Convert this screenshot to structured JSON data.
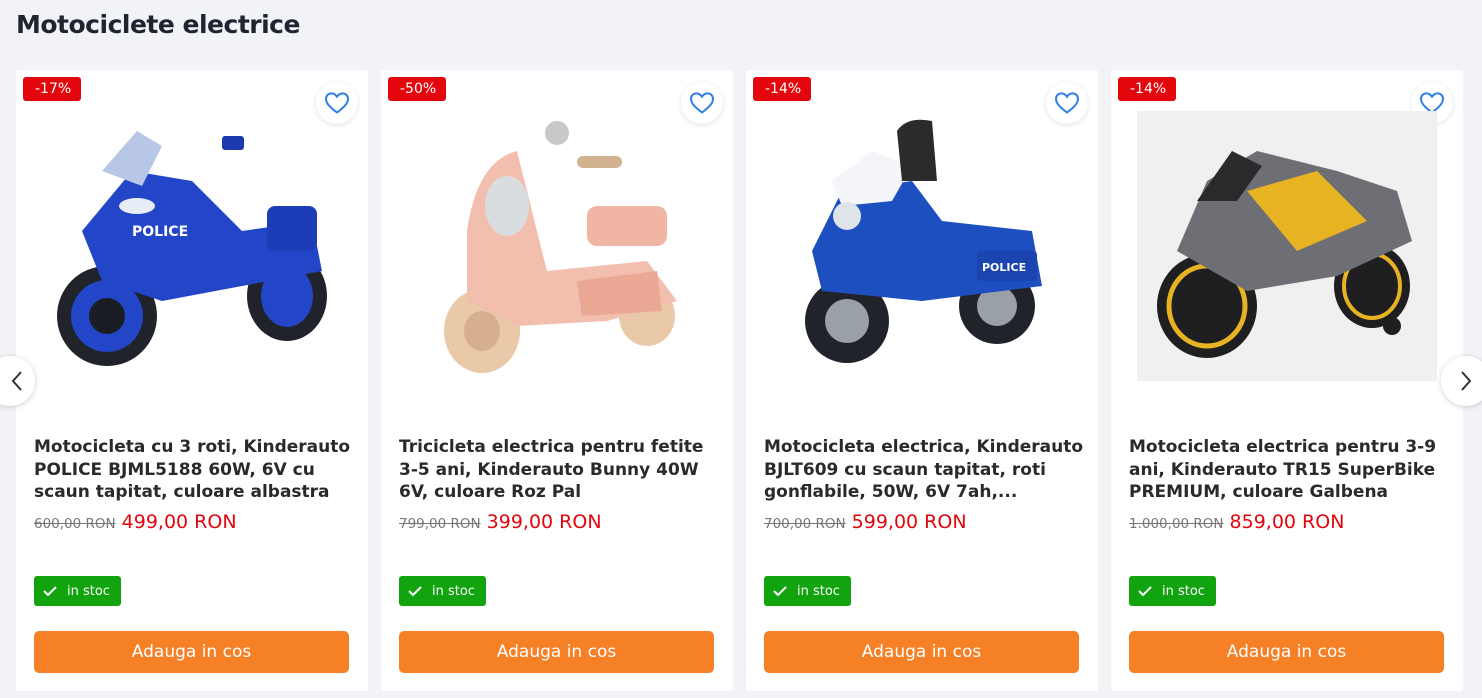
{
  "section": {
    "title": "Motociclete electrice"
  },
  "products": [
    {
      "discount": "-17%",
      "title": "Motocicleta cu 3 roti, Kinderauto POLICE BJML5188 60W, 6V cu scaun tapitat, culoare albastra",
      "old_price": "600,00 RON",
      "new_price": "499,00 RON",
      "stock": "in stoc",
      "button": "Adauga in cos",
      "color": "#2345c8"
    },
    {
      "discount": "-50%",
      "title": "Tricicleta electrica pentru fetite 3-5 ani, Kinderauto Bunny 40W 6V, culoare Roz Pal",
      "old_price": "799,00 RON",
      "new_price": "399,00 RON",
      "stock": "in stoc",
      "button": "Adauga in cos",
      "color": "#f2bfae"
    },
    {
      "discount": "-14%",
      "title": "Motocicleta electrica, Kinderauto BJLT609 cu scaun tapitat, roti gonflabile, 50W, 6V 7ah,...",
      "old_price": "700,00 RON",
      "new_price": "599,00 RON",
      "stock": "in stoc",
      "button": "Adauga in cos",
      "color": "#1e4fc0"
    },
    {
      "discount": "-14%",
      "title": "Motocicleta electrica pentru 3-9 ani, Kinderauto TR15 SuperBike PREMIUM, culoare Galbena",
      "old_price": "1.000,00 RON",
      "new_price": "859,00 RON",
      "stock": "in stoc",
      "button": "Adauga in cos",
      "color": "#e7b322"
    }
  ],
  "icons": {
    "favorite": "heart-icon",
    "stock": "check-icon",
    "prev": "chevron-left-icon",
    "next": "chevron-right-icon"
  },
  "colors": {
    "discount": "#e3060c",
    "price": "#e3060c",
    "stock": "#11a40e",
    "button": "#f58026",
    "heart": "#2f7fe0"
  }
}
